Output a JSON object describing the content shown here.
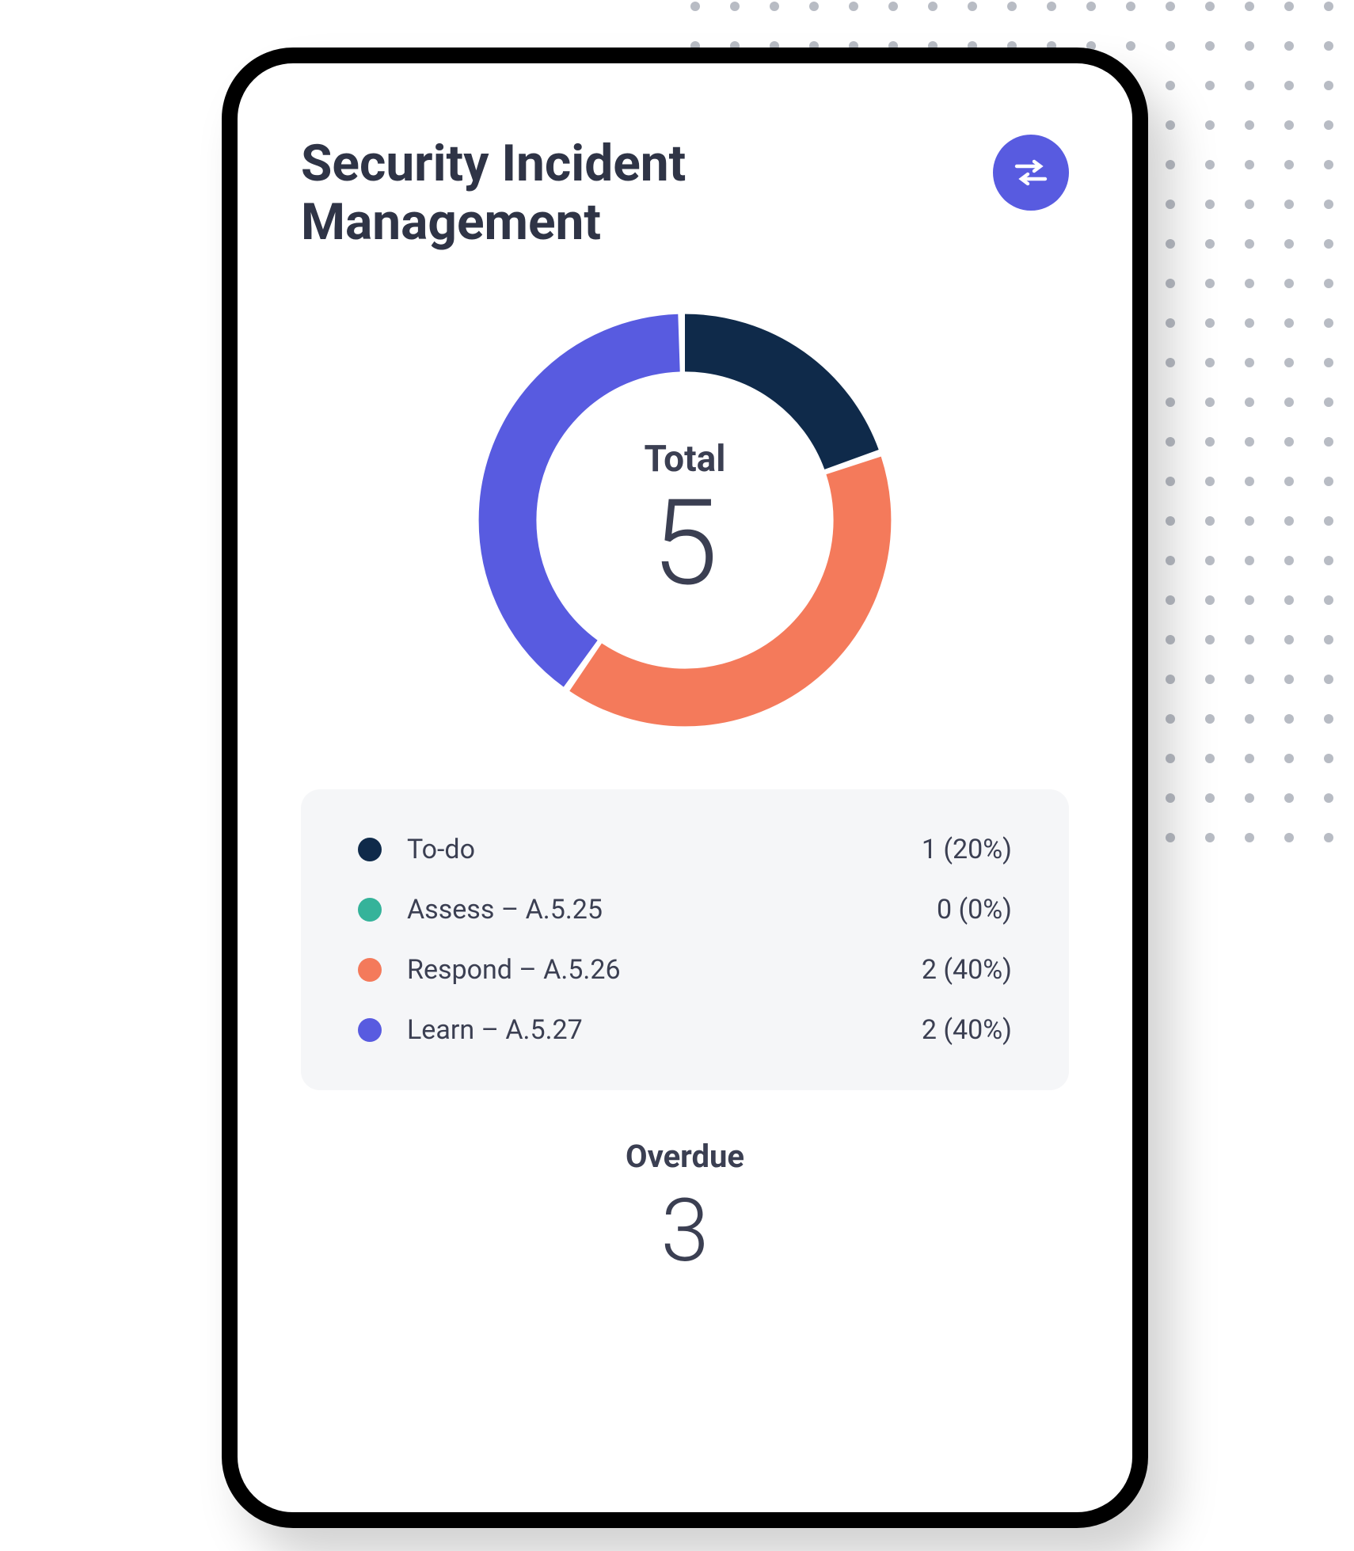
{
  "header": {
    "title": "Security Incident Management"
  },
  "chart_data": {
    "type": "pie",
    "total_label": "Total",
    "total_value": 5,
    "series": [
      {
        "name": "To-do",
        "value": 1,
        "percent": 20,
        "color": "#0f2a4a"
      },
      {
        "name": "Assess – A.5.25",
        "value": 0,
        "percent": 0,
        "color": "#35b39a"
      },
      {
        "name": "Respond – A.5.26",
        "value": 2,
        "percent": 40,
        "color": "#f47a5b"
      },
      {
        "name": "Learn – A.5.27",
        "value": 2,
        "percent": 40,
        "color": "#585be0"
      }
    ]
  },
  "legend": {
    "items": [
      {
        "label": "To-do",
        "value_text": "1 (20%)",
        "color": "#0f2a4a"
      },
      {
        "label": "Assess – A.5.25",
        "value_text": "0 (0%)",
        "color": "#35b39a"
      },
      {
        "label": "Respond – A.5.26",
        "value_text": "2 (40%)",
        "color": "#f47a5b"
      },
      {
        "label": "Learn – A.5.27",
        "value_text": "2 (40%)",
        "color": "#585be0"
      }
    ]
  },
  "overdue": {
    "label": "Overdue",
    "value": 3
  },
  "icons": {
    "filter": "filter-icon"
  }
}
